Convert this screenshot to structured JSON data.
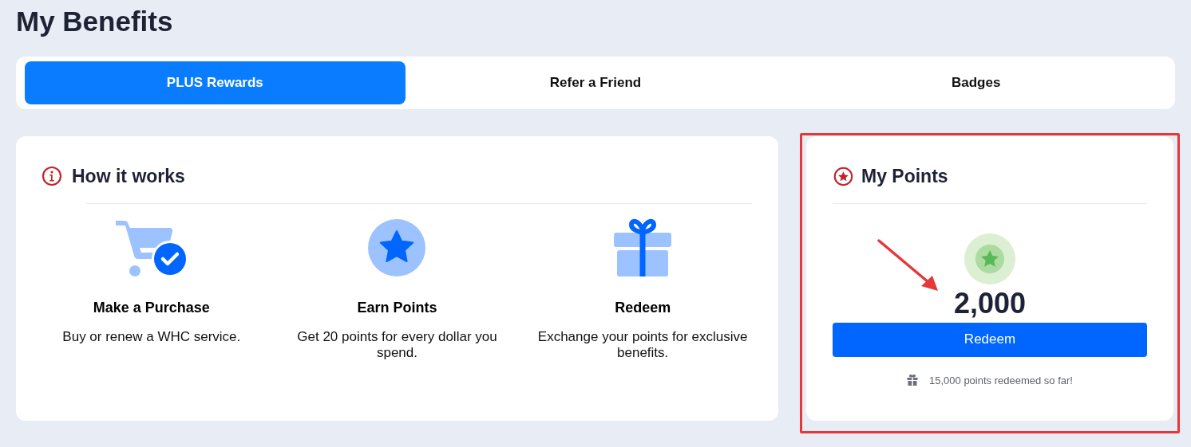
{
  "page_title": "My Benefits",
  "tabs": [
    {
      "label": "PLUS Rewards",
      "selected": true
    },
    {
      "label": "Refer a Friend",
      "selected": false
    },
    {
      "label": "Badges",
      "selected": false
    }
  ],
  "how_it_works": {
    "title": "How it works",
    "steps": [
      {
        "kind": "cart",
        "title": "Make a Purchase",
        "description": "Buy or renew a WHC service."
      },
      {
        "kind": "star",
        "title": "Earn Points",
        "description": "Get 20 points for every dollar you spend."
      },
      {
        "kind": "gift",
        "title": "Redeem",
        "description": "Exchange your points for exclusive benefits."
      }
    ]
  },
  "my_points": {
    "title": "My Points",
    "points": "2,000",
    "button": "Redeem",
    "footer": "15,000 points redeemed so far!"
  }
}
